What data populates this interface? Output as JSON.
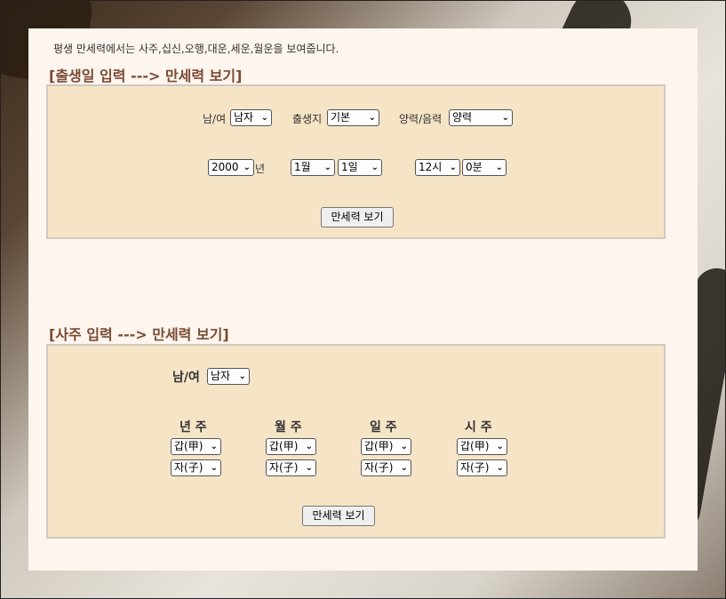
{
  "intro_text": "평생 만세력에서는 사주,십신,오행,대운,세운,월운을 보여줍니다.",
  "birth_section": {
    "title": "[출생일 입력 ---> 만세력 보기]",
    "gender_label": "남/여",
    "gender_value": "남자",
    "birthplace_label": "출생지",
    "birthplace_value": "기본",
    "calendar_label": "양력/음력",
    "calendar_value": "양력",
    "year_value": "2000",
    "year_suffix": "년",
    "month_value": "1월",
    "day_value": "1일",
    "hour_value": "12시",
    "minute_value": "0분",
    "submit_label": "만세력 보기"
  },
  "saju_section": {
    "title": "[사주 입력 ---> 만세력 보기]",
    "gender_label": "남/여",
    "gender_value": "남자",
    "pillars": [
      {
        "label": "년 주",
        "stem": "갑(甲)",
        "branch": "자(子)"
      },
      {
        "label": "월 주",
        "stem": "갑(甲)",
        "branch": "자(子)"
      },
      {
        "label": "일 주",
        "stem": "갑(甲)",
        "branch": "자(子)"
      },
      {
        "label": "시 주",
        "stem": "갑(甲)",
        "branch": "자(子)"
      }
    ],
    "submit_label": "만세력 보기"
  },
  "icons": {
    "dropdown": "chevron-down-icon"
  }
}
